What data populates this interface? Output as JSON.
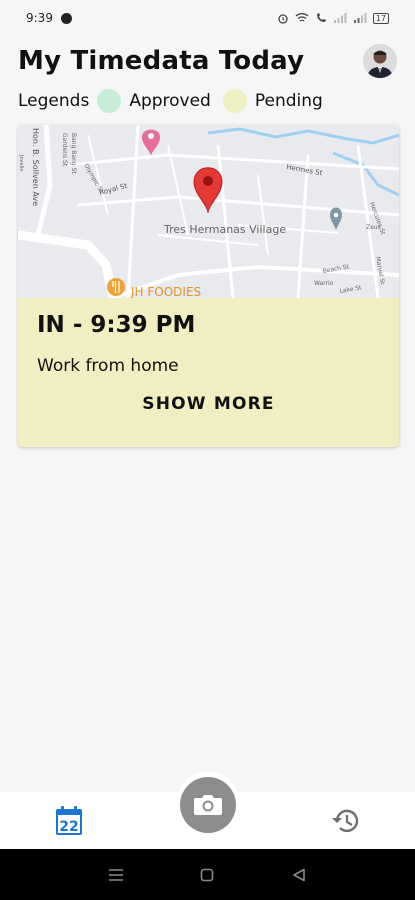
{
  "status_bar": {
    "time": "9:39",
    "battery": "17"
  },
  "header": {
    "title": "My Timedata Today"
  },
  "legends": {
    "label": "Legends",
    "approved": {
      "label": "Approved",
      "color": "#c4ecd7"
    },
    "pending": {
      "label": "Pending",
      "color": "#eef0c2"
    }
  },
  "map": {
    "street_labels": {
      "hermes": "Hermes St",
      "royal": "Royal St",
      "olympic": "Olympic St",
      "gardens": "Gardens St",
      "bang_bang": "Bang Bang St",
      "jovelle": "Jovelle",
      "hon_sollven": "Hon. B. Sollven Ave",
      "hercules": "Hercules St",
      "zeus": "Zeus",
      "beach": "Beach St",
      "warrio": "Warrio",
      "lake": "Lake St",
      "marvel": "Marvel St"
    },
    "place_village": "Tres Hermanas Village",
    "place_food": "JH FOODIES"
  },
  "entry": {
    "title": "IN - 9:39 PM",
    "note": "Work from home",
    "show_more": "SHOW MORE",
    "status_color": "#f1efc2"
  },
  "bottom_nav": {
    "calendar_day": "22"
  }
}
